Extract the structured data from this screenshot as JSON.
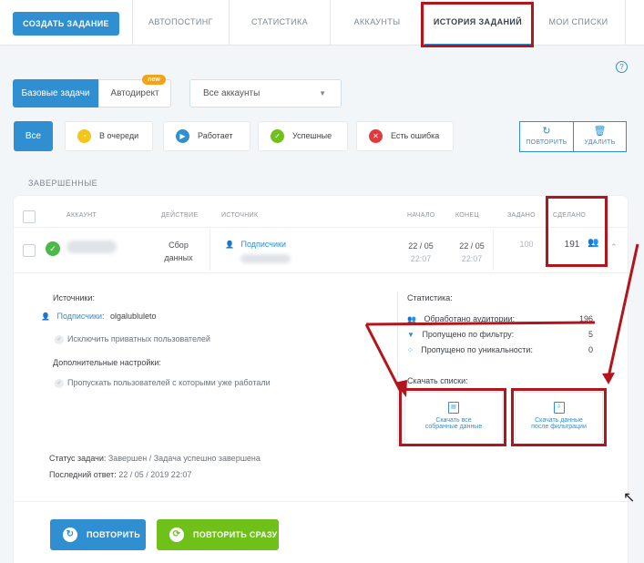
{
  "nav": {
    "create_label": "СОЗДАТЬ ЗАДАНИЕ",
    "tabs": [
      "АВТОПОСТИНГ",
      "СТАТИСТИКА",
      "АККАУНТЫ",
      "ИСТОРИЯ ЗАДАНИЙ",
      "МОИ СПИСКИ"
    ],
    "active_tab": "ИСТОРИЯ ЗАДАНИЙ"
  },
  "help_label": "?",
  "segments": {
    "basic": "Базовые задачи",
    "auto": "Автодирект",
    "new_badge": "new"
  },
  "account_select": {
    "value": "Все аккаунты"
  },
  "filters": {
    "all": "Все",
    "queued": "В очереди",
    "running": "Работает",
    "success": "Успешные",
    "error": "Есть ошибка"
  },
  "actions": {
    "repeat": "ПОВТОРИТЬ",
    "delete": "УДАЛИТЬ"
  },
  "section_title": "ЗАВЕРШЕННЫЕ",
  "table": {
    "headers": {
      "account": "АККАУНТ",
      "action": "ДЕЙСТВИЕ",
      "source": "ИСТОЧНИК",
      "start": "НАЧАЛО",
      "end": "КОНЕЦ",
      "target": "ЗАДАНО",
      "done": "СДЕЛАНО"
    },
    "row": {
      "action_line1": "Сбор",
      "action_line2": "данных",
      "source": "Подписчики",
      "start_date": "22 / 05",
      "start_time": "22:07",
      "end_date": "22 / 05",
      "end_time": "22:07",
      "target": "100",
      "done": "191"
    }
  },
  "details": {
    "sources_label": "Источники:",
    "source_type": "Подписчики:",
    "source_value": "olgalubluleto",
    "exclude_private": "Исключить приватных пользователей",
    "extra_settings": "Дополнительные настройки:",
    "skip_worked": "Пропускать пользователей с которыми уже работали",
    "status_label": "Статус задачи:",
    "status_value": "Завершен / Задача успешно завершена",
    "last_reply_label": "Последний ответ:",
    "last_reply_value": "22 / 05 / 2019 22:07"
  },
  "stats": {
    "title": "Статистика:",
    "processed_label": "Обработано аудитории:",
    "processed_value": "196",
    "filtered_label": "Пропущено по фильтру:",
    "filtered_value": "5",
    "unique_label": "Пропущено по уникальности:",
    "unique_value": "0"
  },
  "downloads": {
    "title": "Скачать списки:",
    "all_line1": "Скачать все",
    "all_line2": "собранные данные",
    "filtered_line1": "Скачать данные",
    "filtered_line2": "после фильтрации"
  },
  "bottom": {
    "repeat": "ПОВТОРИТЬ",
    "repeat_now": "ПОВТОРИТЬ СРАЗУ"
  },
  "colors": {
    "accent": "#2f8fd0",
    "green": "#6fc11a",
    "highlight": "#b3151d"
  }
}
